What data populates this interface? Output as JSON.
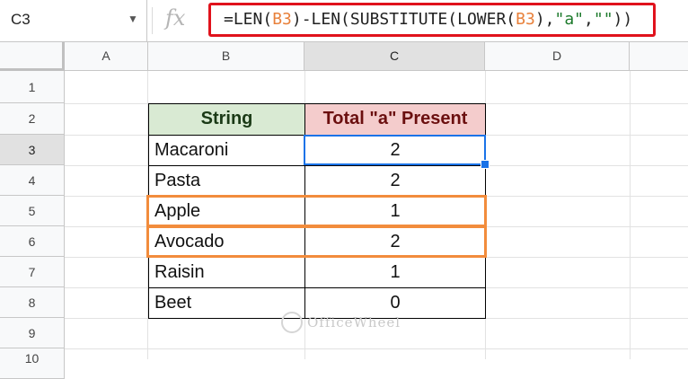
{
  "name_box": {
    "value": "C3"
  },
  "formula_bar": {
    "fx_label": "fx",
    "formula_parts": [
      {
        "text": "=LEN(",
        "kind": "plain"
      },
      {
        "text": "B3",
        "kind": "ref"
      },
      {
        "text": ")-LEN(SUBSTITUTE(LOWER(",
        "kind": "plain"
      },
      {
        "text": "B3",
        "kind": "ref"
      },
      {
        "text": "),",
        "kind": "plain"
      },
      {
        "text": "\"a\"",
        "kind": "string"
      },
      {
        "text": ",",
        "kind": "plain"
      },
      {
        "text": "\"\"",
        "kind": "string"
      },
      {
        "text": "))",
        "kind": "plain"
      }
    ],
    "highlight_color": "#e0121c"
  },
  "columns": [
    "A",
    "B",
    "C",
    "D"
  ],
  "rows": [
    "1",
    "2",
    "3",
    "4",
    "5",
    "6",
    "7",
    "8",
    "9",
    "10"
  ],
  "table": {
    "headers": {
      "string": "String",
      "total": "Total \"a\" Present"
    },
    "rows": [
      {
        "string": "Macaroni",
        "total": "2"
      },
      {
        "string": "Pasta",
        "total": "2"
      },
      {
        "string": "Apple",
        "total": "1"
      },
      {
        "string": "Avocado",
        "total": "2"
      },
      {
        "string": "Raisin",
        "total": "1"
      },
      {
        "string": "Beet",
        "total": "0"
      }
    ]
  },
  "selected_cell": "C3",
  "highlighted_rows": [
    "5",
    "6"
  ],
  "colors": {
    "header_string_bg": "#d9ead3",
    "header_total_bg": "#f4cccc",
    "selection": "#1a73e8",
    "row_highlight": "#f28c3c"
  },
  "watermark": "OfficeWheel"
}
